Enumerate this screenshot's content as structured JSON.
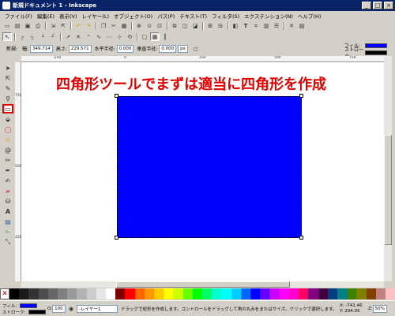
{
  "window": {
    "title": "新規ドキュメント 1 - Inkscape",
    "min": "_",
    "max": "□",
    "close": "×"
  },
  "menu": [
    "ファイル(F)",
    "編集(E)",
    "表示(V)",
    "レイヤー(L)",
    "オブジェクト(O)",
    "パス(P)",
    "テキスト(T)",
    "フィルタ(S)",
    "エクステンション(N)",
    "ヘルプ(H)"
  ],
  "toolbar1": [
    "new-icon",
    "open-icon",
    "save-icon",
    "print-icon",
    "import-icon",
    "export-icon",
    "undo-icon",
    "redo-icon",
    "copy-icon",
    "cut-icon",
    "paste-icon",
    "zoom-selection-icon",
    "zoom-drawing-icon",
    "zoom-page-icon",
    "duplicate-icon",
    "clone-icon",
    "unlink-icon",
    "group-icon",
    "ungroup-icon",
    "fill-stroke-icon",
    "text-tool-icon",
    "xml-editor-icon",
    "align-icon",
    "preferences-icon",
    "document-properties-icon"
  ],
  "toolbar2": [
    "snap-enable-icon",
    "snap-bbox-icon",
    "snap-bbox-edge-icon",
    "snap-bbox-corner-icon",
    "snap-nodes-icon",
    "snap-paths-icon",
    "snap-intersection-icon",
    "snap-cusp-icon",
    "snap-smooth-icon",
    "snap-midpoint-icon",
    "snap-center-icon",
    "snap-rotation-icon",
    "snap-page-icon",
    "snap-grid-icon",
    "snap-guide-icon"
  ],
  "rect_toolbar": {
    "new_label": "新規:",
    "width_label": "幅:",
    "width_value": "349.714",
    "height_label": "高さ:",
    "height_value": "229.571",
    "rx_label": "水平半径:",
    "rx_value": "0.000",
    "ry_label": "垂直半径:",
    "ry_value": "0.000",
    "unit": "px"
  },
  "style_indicator": {
    "fill_label": "フィル:",
    "stroke_label": "ストローク:",
    "fill_color": "#0000ff",
    "stroke_color": "#000000"
  },
  "rulers": {
    "h_ticks": [
      "-250",
      "0",
      "250",
      "500",
      "750"
    ],
    "v_ticks": [
      "750",
      "500",
      "250"
    ]
  },
  "toolbox": [
    "select-tool-icon",
    "node-tool-icon",
    "tweak-tool-icon",
    "zoom-tool-icon",
    "rectangle-tool-icon",
    "3d-box-tool-icon",
    "ellipse-tool-icon",
    "star-tool-icon",
    "spiral-tool-icon",
    "pencil-tool-icon",
    "pen-tool-icon",
    "calligraphy-tool-icon",
    "eraser-tool-icon",
    "bucket-tool-icon",
    "text-tool-icon",
    "gradient-tool-icon",
    "connector-tool-icon",
    "dropper-tool-icon"
  ],
  "canvas": {
    "caption": "四角形ツールでまずは適当に四角形を作成",
    "rect_color": "#0000ff"
  },
  "palette": [
    "#000000",
    "#1a1a1a",
    "#333333",
    "#4d4d4d",
    "#666666",
    "#808080",
    "#999999",
    "#b3b3b3",
    "#cccccc",
    "#e6e6e6",
    "#ffffff",
    "#800000",
    "#ff0000",
    "#ff6600",
    "#ff9900",
    "#ffcc00",
    "#ffff00",
    "#ccff00",
    "#66ff00",
    "#00ff00",
    "#00ff66",
    "#00ffcc",
    "#00ffff",
    "#00ccff",
    "#0066ff",
    "#0000ff",
    "#6600ff",
    "#cc00ff",
    "#ff00ff",
    "#ff00cc",
    "#ff0066",
    "#800080",
    "#400040",
    "#004080",
    "#008080",
    "#408000",
    "#808000",
    "#804000",
    "#c08080",
    "#ffc0c0"
  ],
  "status": {
    "fill_label": "フィル:",
    "stroke_label": "ストローク:",
    "opacity_label": "O:",
    "opacity_value": "100",
    "layer": "-レイヤー1",
    "message": "ドラッグで矩形を作成します。コントロールをドラッグして角の丸みをまたはサイズ。クリックで選択します。",
    "x": "X: -741.46",
    "y": "Y:   294.05",
    "zoom_label": "Z:",
    "zoom_value": "50%"
  }
}
